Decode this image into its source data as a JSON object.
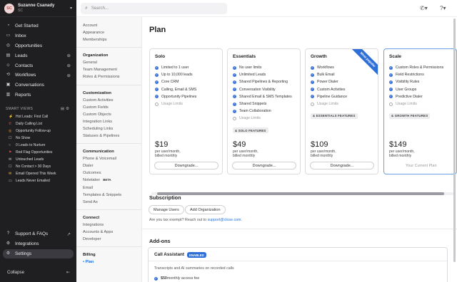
{
  "user": {
    "initials": "SC",
    "name": "Suzanne Csanady",
    "org": "SC",
    "caret": "▾"
  },
  "nav": [
    {
      "label": "Get Started",
      "icon": "rocket-icon",
      "glyph": "◔"
    },
    {
      "label": "Inbox",
      "icon": "inbox-icon",
      "glyph": "▭"
    },
    {
      "label": "Opportunities",
      "icon": "target-icon",
      "glyph": "◎"
    },
    {
      "label": "Leads",
      "icon": "building-icon",
      "glyph": "▤",
      "plus": "⊕"
    },
    {
      "label": "Contacts",
      "icon": "person-icon",
      "glyph": "☺",
      "plus": "⊕"
    },
    {
      "label": "Workflows",
      "icon": "workflow-icon",
      "glyph": "⟲",
      "plus": "⊕"
    },
    {
      "label": "Conversations",
      "icon": "chat-icon",
      "glyph": "▣"
    },
    {
      "label": "Reports",
      "icon": "chart-icon",
      "glyph": "▥"
    }
  ],
  "smart_views": {
    "heading": "SMART VIEWS",
    "items": [
      {
        "label": "Hot Leads: First Call",
        "glyph": "⚡",
        "color": "#f0c040"
      },
      {
        "label": "Daily Calling List",
        "glyph": "✆",
        "color": "#e0583a"
      },
      {
        "label": "Opportunity Follow-up",
        "glyph": "◎",
        "color": "#f0a030"
      },
      {
        "label": "No Show",
        "glyph": "☐",
        "color": "#cccccc"
      },
      {
        "label": "0 Leads to Nurture",
        "glyph": "○",
        "color": "#cccccc"
      },
      {
        "label": "Red Flag Opportunities",
        "glyph": "⚑",
        "color": "#e04444"
      },
      {
        "label": "Untouched Leads",
        "glyph": "✉",
        "color": "#cccccc"
      },
      {
        "label": "No Contact > 30 Days",
        "glyph": "☐",
        "color": "#cccccc"
      },
      {
        "label": "Email Opened This Week",
        "glyph": "✉",
        "color": "#f0c040"
      },
      {
        "label": "Leads Never Emailed",
        "glyph": "▭",
        "color": "#cccccc"
      }
    ]
  },
  "bottom_nav": [
    {
      "label": "Support & FAQs",
      "icon": "help-icon",
      "glyph": "?",
      "ext": "↗"
    },
    {
      "label": "Integrations",
      "icon": "plug-icon",
      "glyph": "⚙"
    },
    {
      "label": "Settings",
      "icon": "gear-icon",
      "glyph": "⚙"
    }
  ],
  "collapse": {
    "label": "Collapse",
    "shortcut": "⇤"
  },
  "search": {
    "placeholder": "Search..."
  },
  "settings_nav": [
    {
      "title": "",
      "items": [
        "Account",
        "Appearance",
        "Memberships"
      ]
    },
    {
      "title": "Organization",
      "items": [
        "General",
        "Team Management",
        "Roles & Permissions"
      ]
    },
    {
      "title": "Customization",
      "items": [
        "Custom Activities",
        "Custom Fields",
        "Custom Objects",
        "Integration Links",
        "Scheduling Links",
        "Statuses & Pipelines"
      ]
    },
    {
      "title": "Communication",
      "items": [
        "Phone & Voicemail",
        "Dialer",
        "Outcomes",
        "Notetaker",
        "Email",
        "Templates & Snippets",
        "Send As"
      ]
    },
    {
      "title": "Connect",
      "items": [
        "Integrations",
        "Accounts & Apps",
        "Developer"
      ]
    },
    {
      "title": "Billing",
      "items": [
        "Plan"
      ]
    }
  ],
  "beta_label": "BETA",
  "page": {
    "title": "Plan"
  },
  "plans": [
    {
      "name": "Solo",
      "features": [
        "Limited to 1 user",
        "Up to 10,000 leads",
        "Core CRM",
        "Calling, Email & SMS",
        "Opportunity Pipelines"
      ],
      "muted": [
        "Usage Limits"
      ],
      "tag": "",
      "price": "$19",
      "per1": "per user/month,",
      "per2": "billed monthly",
      "button": "Downgrade..."
    },
    {
      "name": "Essentials",
      "features": [
        "No user limits",
        "Unlimited Leads",
        "Shared Pipelines & Reporting",
        "Conversation Visibility",
        "Shared Email & SMS Templates",
        "Shared Snippets",
        "Team Collaboration"
      ],
      "muted": [
        "Usage Limits"
      ],
      "tag": "& SOLO FEATURES",
      "price": "$49",
      "per1": "per user/month,",
      "per2": "billed monthly",
      "button": "Downgrade..."
    },
    {
      "name": "Growth",
      "ribbon": "Most popular",
      "features": [
        "Workflows",
        "Bulk Email",
        "Power Dialer",
        "Custom Activities",
        "Pipeline Guidance"
      ],
      "muted": [
        "Usage Limits"
      ],
      "tag": "& ESSENTIALS FEATURES",
      "price": "$109",
      "per1": "per user/month,",
      "per2": "billed monthly",
      "button": "Downgrade..."
    },
    {
      "name": "Scale",
      "features": [
        "Custom Roles & Permissions",
        "Field Restrictions",
        "Visibility Rules",
        "User Groups",
        "Predictive Dialer"
      ],
      "muted": [
        "Usage Limits"
      ],
      "tag": "& GROWTH FEATURES",
      "price": "$149",
      "per1": "per user/month,",
      "per2": "billed monthly",
      "current": "Your Current Plan"
    }
  ],
  "subscription": {
    "title": "Subscription",
    "manage_users": "Manage Users",
    "add_org": "Add Organization",
    "tax_text": "Are you tax exempt? Reach out to ",
    "tax_link": "support@close.com",
    "tax_end": "."
  },
  "addons": {
    "title": "Add-ons",
    "call_assistant": {
      "name": "Call Assistant",
      "badge": "ENABLED",
      "desc": "Transcripts and AI summaries on recorded calls",
      "price": "$50",
      "price_suffix": " monthly access fee"
    }
  },
  "colors": {
    "accent": "#2d6fd6",
    "sidebar_bg": "#1f1f22",
    "link": "#1a73e8"
  }
}
